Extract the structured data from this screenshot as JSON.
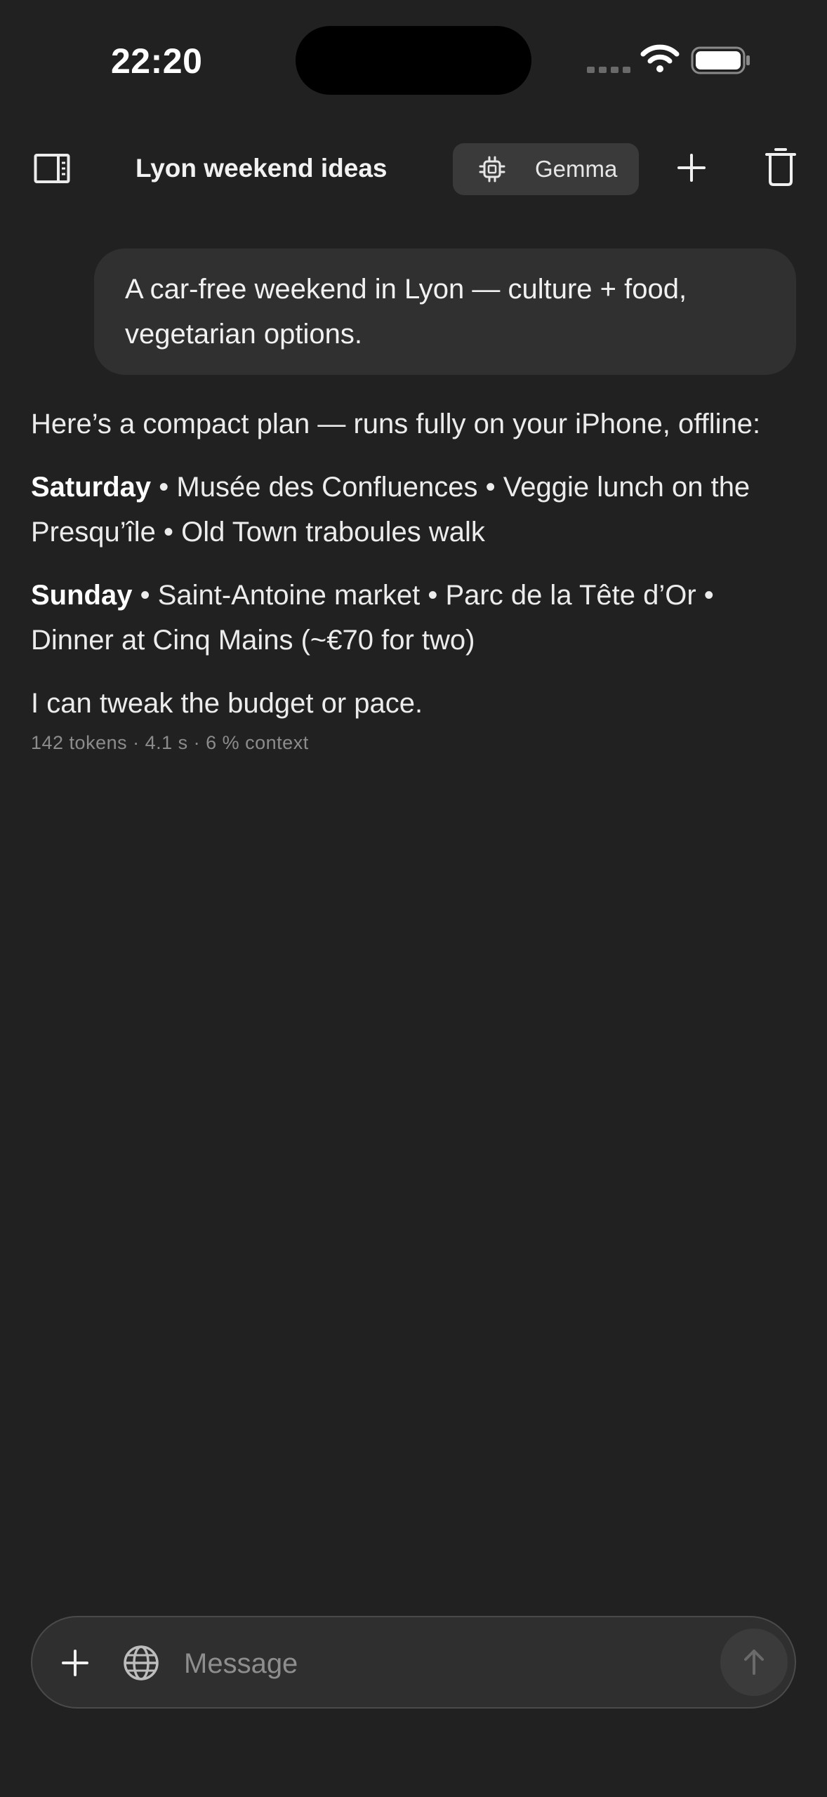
{
  "status_bar": {
    "time": "22:20"
  },
  "header": {
    "title": "Lyon weekend ideas",
    "model_label": "Gemma"
  },
  "messages": {
    "user": "A car-free weekend in Lyon — culture + food, vegetarian options.",
    "assistant": {
      "intro": "Here’s a compact plan — runs fully on your iPhone, offline:",
      "saturday_label": "Saturday",
      "saturday_items": " • Musée des Confluences • Veggie lunch on the Presqu’île • Old Town traboules walk",
      "sunday_label": "Sunday",
      "sunday_items": " • Saint-Antoine market • Parc de la Tête d’Or • Dinner at Cinq Mains (~€70 for two)",
      "closing": "I can tweak the budget or pace.",
      "meta": "142 tokens · 4.1 s · 6 % context"
    }
  },
  "composer": {
    "placeholder": "Message"
  },
  "icons": {
    "sidebar_toggle": "sidebar-icon",
    "model": "chip-icon",
    "new_chat": "plus-icon",
    "delete": "trash-icon",
    "attach": "plus-icon",
    "web": "globe-icon",
    "send": "arrow-up-icon"
  }
}
